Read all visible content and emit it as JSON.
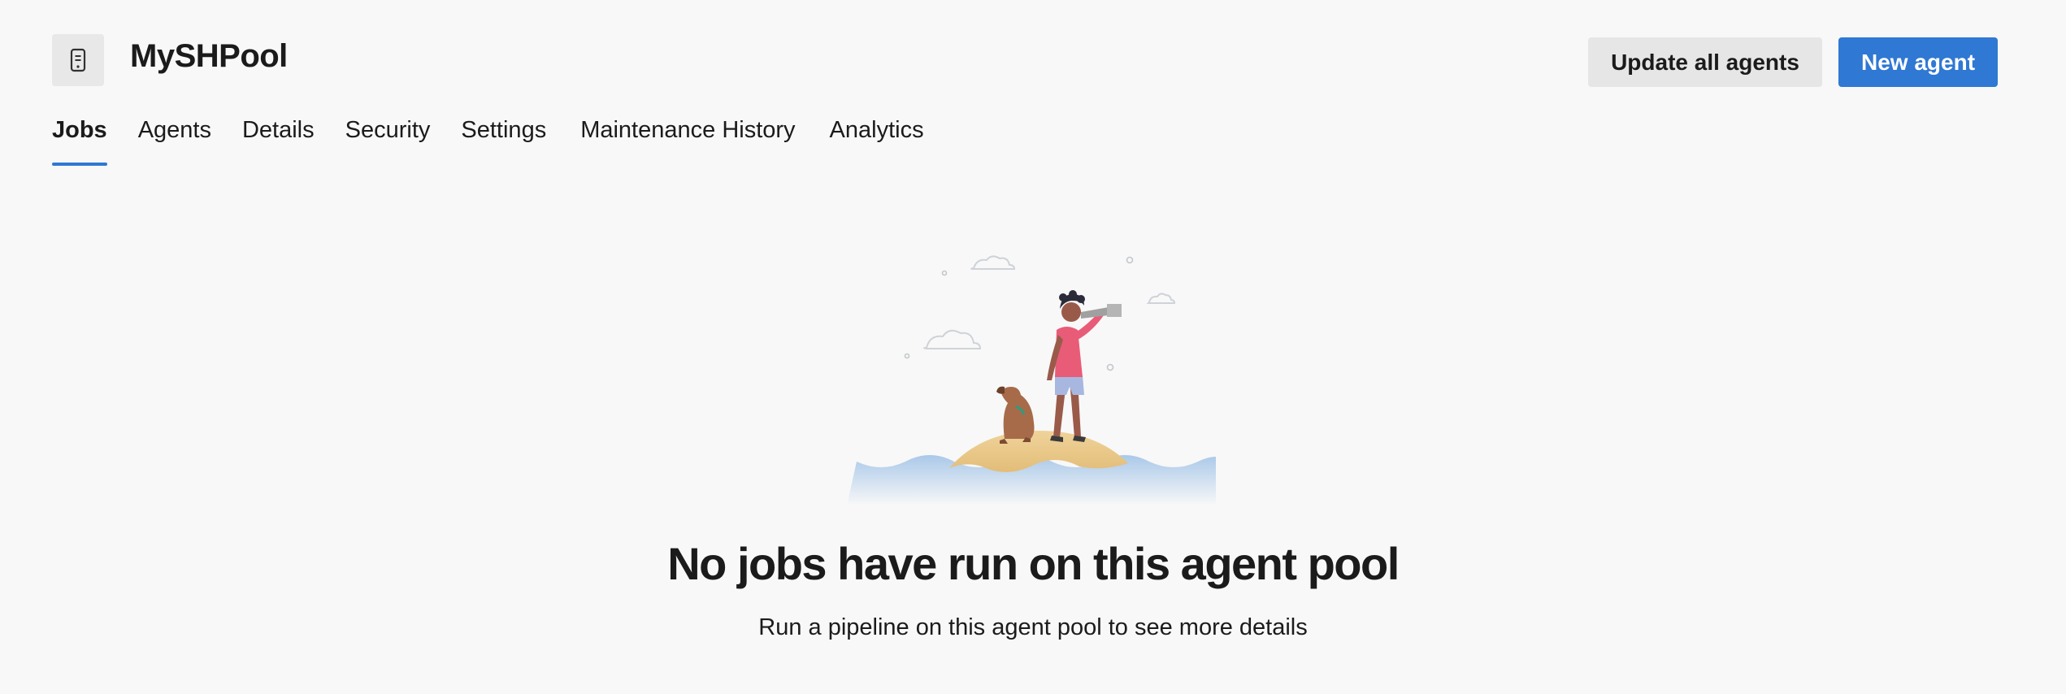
{
  "header": {
    "pool_icon": "phone-agent-icon",
    "title": "MySHPool",
    "buttons": {
      "update_all": "Update all agents",
      "new_agent": "New agent"
    }
  },
  "tabs": [
    {
      "label": "Jobs",
      "active": true
    },
    {
      "label": "Agents",
      "active": false
    },
    {
      "label": "Details",
      "active": false
    },
    {
      "label": "Security",
      "active": false
    },
    {
      "label": "Settings",
      "active": false
    },
    {
      "label": "Maintenance History",
      "active": false
    },
    {
      "label": "Analytics",
      "active": false
    }
  ],
  "empty_state": {
    "illustration": "person-with-telescope-and-dog-on-island-illustration",
    "title": "No jobs have run on this agent pool",
    "subtitle": "Run a pipeline on this agent pool to see more details"
  },
  "colors": {
    "accent": "#2f78d3",
    "background": "#f8f8f8",
    "secondary_button": "#e6e6e6"
  }
}
